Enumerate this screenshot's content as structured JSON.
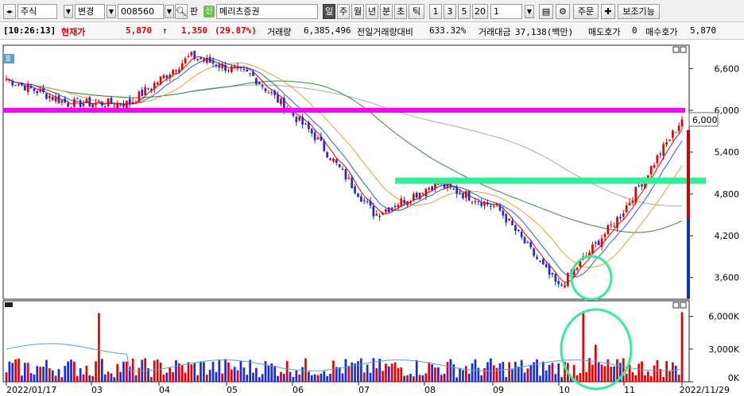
{
  "toolbar": {
    "market_type": "주식",
    "change_label": "변경",
    "stock_code": "008560",
    "pan_label": "판",
    "sin_label": "신",
    "stock_name": "메리츠증권",
    "periods": [
      "일",
      "주",
      "월",
      "년",
      "분",
      "초",
      "틱"
    ],
    "active_period": "일",
    "minutes": [
      "1",
      "3",
      "5",
      "20"
    ],
    "count_value": "1",
    "order_label": "주문",
    "indicator_label": "보조기능"
  },
  "status": {
    "time": "[10:26:13]",
    "price_label": "현재가",
    "price": "5,870",
    "arrow": "↑",
    "change": "1,350",
    "change_pct": "(29.87%)",
    "volume_label": "거래량",
    "volume": "6,385,496",
    "prev_ratio_label": "전일거래량대비",
    "prev_ratio": "633.32%",
    "amount_label": "거래대금",
    "amount": "37,138(백만)",
    "ask_label": "매도호가",
    "ask": "0",
    "bid_label": "매수호가",
    "bid": "5,870"
  },
  "chart_data": {
    "type": "candlestick",
    "period": "daily",
    "x_labels": [
      "2022/01/17",
      "03",
      "04",
      "05",
      "06",
      "07",
      "08",
      "09",
      "10",
      "11",
      "2022/11/29"
    ],
    "y_ticks": [
      "6,600",
      "6,000",
      "5,400",
      "4,800",
      "4,200",
      "3,600"
    ],
    "ylim": [
      3300,
      6900
    ],
    "marked_level": "6,000",
    "horizontal_lines": [
      {
        "price": 6000,
        "color": "#ff00ff"
      },
      {
        "price": 4990,
        "color": "#33ee99"
      }
    ],
    "close_series_approx": [
      {
        "month": "2022/01",
        "close": 6450
      },
      {
        "month": "02",
        "close": 6100
      },
      {
        "month": "03",
        "close": 6100
      },
      {
        "month": "04",
        "close": 6780
      },
      {
        "month": "05",
        "close": 6500
      },
      {
        "month": "06",
        "close": 5650
      },
      {
        "month": "07",
        "close": 4500
      },
      {
        "month": "08",
        "close": 4950
      },
      {
        "month": "09",
        "close": 4600
      },
      {
        "month": "10",
        "close": 3450
      },
      {
        "month": "11",
        "close": 4500
      },
      {
        "month": "2022/11/29",
        "close": 5870
      }
    ],
    "volume_ticks": [
      "6,000K",
      "3,000K",
      "0K"
    ],
    "volume_ylim": [
      0,
      7000000
    ],
    "colors": {
      "up": "#e60000",
      "down": "#1a2bd9",
      "ma5": "#e60000",
      "ma10": "#2a5bd7",
      "ma20": "#e8a030",
      "ma60": "#2e8b2e",
      "ma120": "#a8a8a8",
      "volume_ma": "#4aa3e0",
      "magenta_line": "#ff00ff",
      "green_line": "#33ee99"
    }
  }
}
